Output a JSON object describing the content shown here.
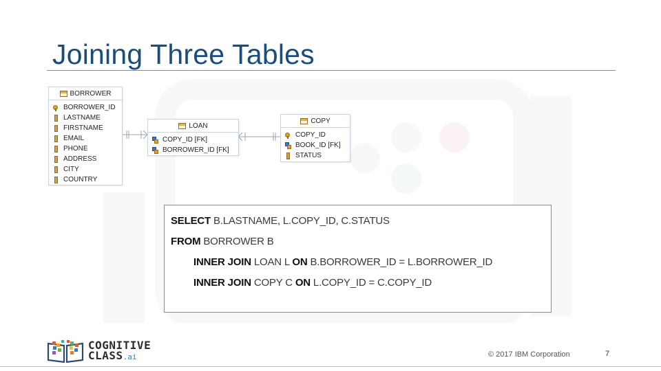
{
  "slide": {
    "title": "Joining Three Tables",
    "page_number": "7",
    "copyright": "© 2017 IBM Corporation"
  },
  "diagram": {
    "borrower": {
      "name": "BORROWER",
      "columns": [
        {
          "label": "BORROWER_ID",
          "icon": "primary-key-icon"
        },
        {
          "label": "LASTNAME",
          "icon": "column-icon"
        },
        {
          "label": "FIRSTNAME",
          "icon": "column-icon"
        },
        {
          "label": "EMAIL",
          "icon": "column-icon"
        },
        {
          "label": "PHONE",
          "icon": "column-icon"
        },
        {
          "label": "ADDRESS",
          "icon": "column-icon"
        },
        {
          "label": "CITY",
          "icon": "column-icon"
        },
        {
          "label": "COUNTRY",
          "icon": "column-icon"
        }
      ]
    },
    "loan": {
      "name": "LOAN",
      "columns": [
        {
          "label": "COPY_ID [FK]",
          "icon": "foreign-key-icon"
        },
        {
          "label": "BORROWER_ID [FK]",
          "icon": "foreign-key-icon"
        }
      ]
    },
    "copy": {
      "name": "COPY",
      "columns": [
        {
          "label": "COPY_ID",
          "icon": "primary-key-icon"
        },
        {
          "label": "BOOK_ID [FK]",
          "icon": "foreign-key-icon"
        },
        {
          "label": "STATUS",
          "icon": "column-icon"
        }
      ]
    }
  },
  "sql": {
    "line1": {
      "keyword": "SELECT",
      "rest": "B.LASTNAME, L.COPY_ID, C.STATUS"
    },
    "line2": {
      "keyword": "FROM",
      "rest": "BORROWER B"
    },
    "line3": {
      "keyword1": "INNER JOIN",
      "rest1": "LOAN L",
      "keyword2": "ON",
      "rest2": "B.BORROWER_ID = L.BORROWER_ID"
    },
    "line4": {
      "keyword1": "INNER JOIN",
      "rest1": "COPY C",
      "keyword2": "ON",
      "rest2": "L.COPY_ID = C.COPY_ID"
    }
  },
  "logo": {
    "line1": "COGNITIVE",
    "line2": "CLASS",
    "suffix": ".ai"
  },
  "colors": {
    "title": "#1a4d7c",
    "accent_blue": "#3a78c8"
  }
}
